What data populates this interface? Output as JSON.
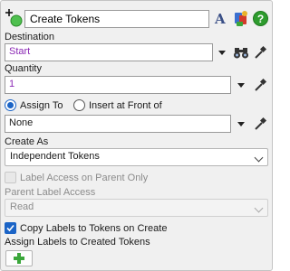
{
  "header": {
    "title": "Create Tokens",
    "icons": [
      "add-object-icon",
      "font-icon",
      "palette-icon",
      "help-icon"
    ],
    "help_glyph": "?",
    "font_glyph": "A"
  },
  "destination": {
    "label": "Destination",
    "value": "Start"
  },
  "quantity": {
    "label": "Quantity",
    "value": "1"
  },
  "assign": {
    "option_assign": "Assign To",
    "option_insert": "Insert at Front of",
    "selected": "Assign To",
    "value": "None"
  },
  "create_as": {
    "label": "Create As",
    "value": "Independent Tokens"
  },
  "label_access": {
    "label": "Label Access on Parent Only",
    "checked": false,
    "disabled": true
  },
  "parent_label_access": {
    "label": "Parent Label Access",
    "value": "Read",
    "disabled": true
  },
  "copy_labels": {
    "label": "Copy Labels to Tokens on Create",
    "checked": true
  },
  "assign_labels": {
    "label": "Assign Labels to Created Tokens"
  },
  "colors": {
    "accent": "#1b64c6",
    "purple_value": "#8b28b4",
    "help_green": "#2e9c2e",
    "add_green": "#3aa63a"
  }
}
